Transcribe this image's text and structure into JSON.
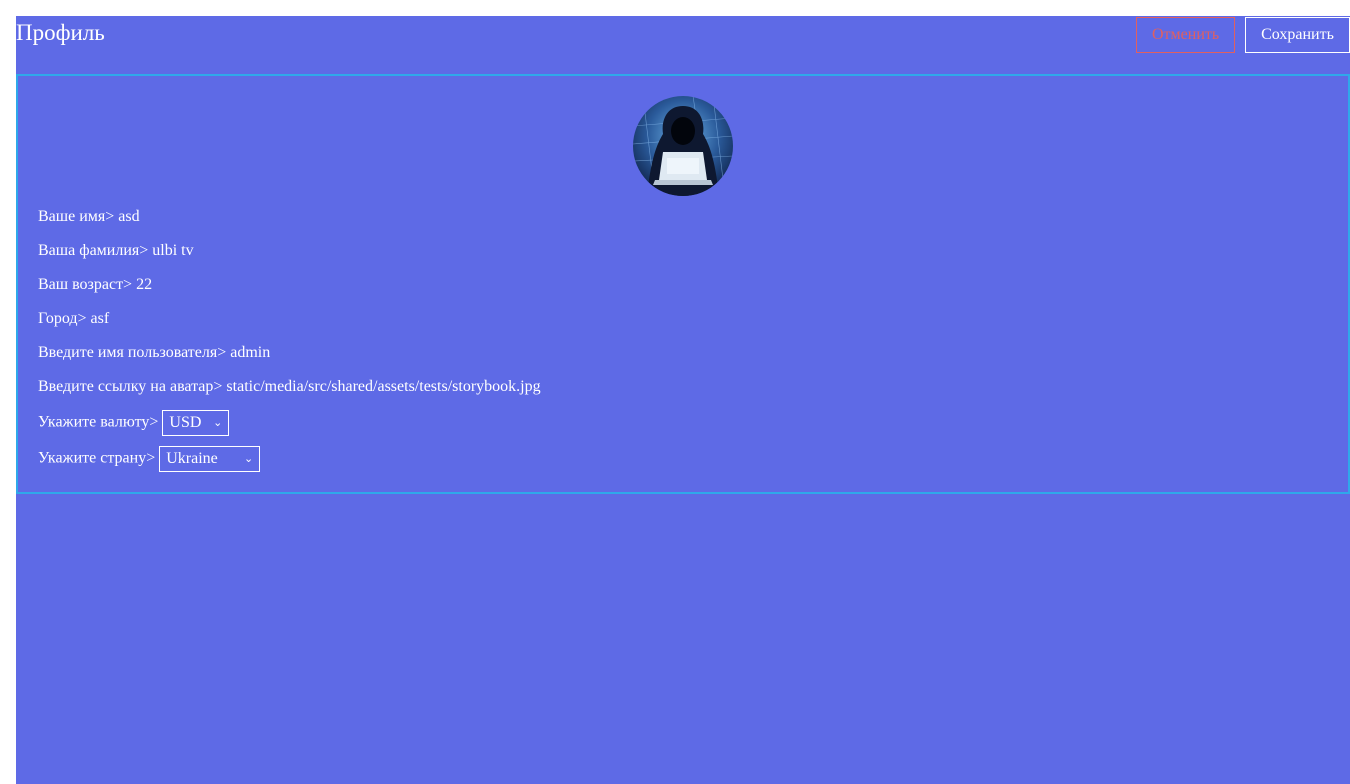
{
  "header": {
    "title": "Профиль",
    "cancel_label": "Отменить",
    "save_label": "Сохранить"
  },
  "profile": {
    "avatar_icon": "hooded-hacker-avatar",
    "rows": [
      {
        "label": "Ваше имя>",
        "value": "asd"
      },
      {
        "label": "Ваша фамилия>",
        "value": "ulbi tv"
      },
      {
        "label": "Ваш возраст>",
        "value": "22"
      },
      {
        "label": "Город>",
        "value": "asf"
      },
      {
        "label": "Введите имя пользователя>",
        "value": "admin"
      },
      {
        "label": "Введите ссылку на аватар>",
        "value": "static/media/src/shared/assets/tests/storybook.jpg"
      }
    ],
    "currency": {
      "label": "Укажите валюту>",
      "selected": "USD"
    },
    "country": {
      "label": "Укажите страну>",
      "selected": "Ukraine"
    }
  },
  "colors": {
    "background": "#5e6ae6",
    "card_border": "#2fa8ea",
    "cancel": "#e06060",
    "text": "#ffffff"
  }
}
